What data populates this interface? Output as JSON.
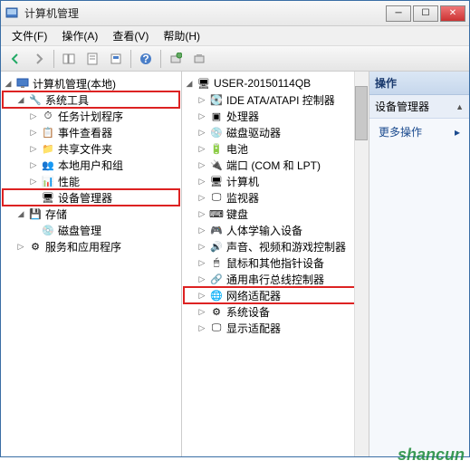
{
  "window": {
    "title": "计算机管理"
  },
  "menubar": {
    "file": "文件(F)",
    "action": "操作(A)",
    "view": "查看(V)",
    "help": "帮助(H)"
  },
  "left_tree": {
    "root": "计算机管理(本地)",
    "systools": "系统工具",
    "systools_children": {
      "task_scheduler": "任务计划程序",
      "event_viewer": "事件查看器",
      "shared_folders": "共享文件夹",
      "local_users": "本地用户和组",
      "performance": "性能",
      "device_manager": "设备管理器"
    },
    "storage": "存储",
    "storage_children": {
      "disk_mgmt": "磁盘管理"
    },
    "services": "服务和应用程序"
  },
  "mid_tree": {
    "root": "USER-20150114QB",
    "items": {
      "ide": "IDE ATA/ATAPI 控制器",
      "processor": "处理器",
      "disk_drive": "磁盘驱动器",
      "battery": "电池",
      "port": "端口 (COM 和 LPT)",
      "computer": "计算机",
      "monitor": "监视器",
      "keyboard": "键盘",
      "hid": "人体学输入设备",
      "sound": "声音、视频和游戏控制器",
      "mouse": "鼠标和其他指针设备",
      "usb": "通用串行总线控制器",
      "network": "网络适配器",
      "system": "系统设备",
      "display": "显示适配器"
    }
  },
  "actions": {
    "header": "操作",
    "section": "设备管理器",
    "more": "更多操作"
  },
  "watermark": "shancun"
}
